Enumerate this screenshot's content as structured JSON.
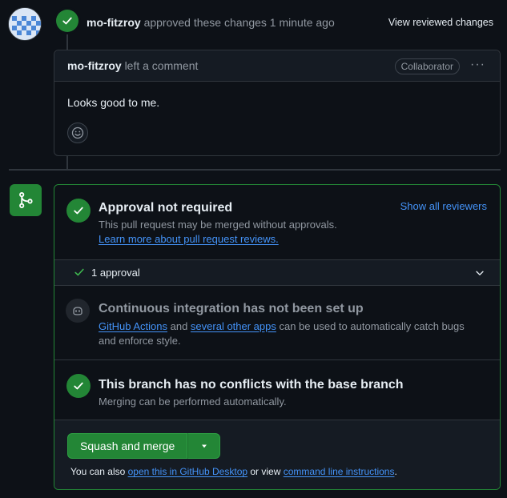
{
  "review": {
    "user": "mo-fitzroy",
    "action": "approved these changes",
    "time": "1 minute ago",
    "view_changes": "View reviewed changes"
  },
  "comment": {
    "user": "mo-fitzroy",
    "action": "left a comment",
    "badge": "Collaborator",
    "menu": "···",
    "body": "Looks good to me."
  },
  "merge": {
    "approval": {
      "title": "Approval not required",
      "subtitle": "This pull request may be merged without approvals.",
      "learn_more": "Learn more about pull request reviews.",
      "show_reviewers": "Show all reviewers",
      "count_label": "1 approval"
    },
    "ci": {
      "title": "Continuous integration has not been set up",
      "link1": "GitHub Actions",
      "text1": " and ",
      "link2": "several other apps",
      "text2": " can be used to automatically catch bugs",
      "text3": "and enforce style."
    },
    "conflicts": {
      "title": "This branch has no conflicts with the base branch",
      "subtitle": "Merging can be performed automatically."
    },
    "action": {
      "button": "Squash and merge",
      "note_prefix": "You can also ",
      "link_desktop": "open this in GitHub Desktop",
      "note_mid": " or view ",
      "link_cli": "command line instructions",
      "note_suffix": "."
    }
  },
  "colors": {
    "background": "#0d1117",
    "success": "#238636",
    "link": "#4493f8",
    "muted": "#9198a1",
    "border": "#30363d"
  },
  "icons": [
    "avatar-identicon",
    "check-icon",
    "kebab-icon",
    "smiley-icon",
    "git-merge-icon",
    "copilot-icon",
    "chevron-down-icon",
    "triangle-down-icon"
  ]
}
